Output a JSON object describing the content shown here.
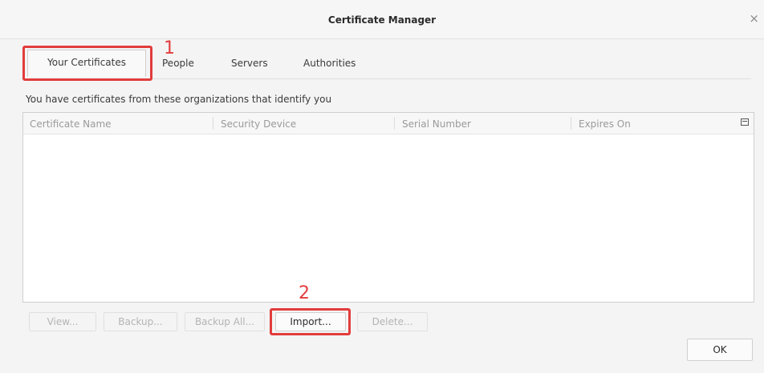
{
  "window": {
    "title": "Certificate Manager",
    "close_glyph": "×"
  },
  "tabs": [
    {
      "label": "Your Certificates",
      "selected": true
    },
    {
      "label": "People",
      "selected": false
    },
    {
      "label": "Servers",
      "selected": false
    },
    {
      "label": "Authorities",
      "selected": false
    }
  ],
  "description": "You have certificates from these organizations that identify you",
  "table": {
    "columns": [
      "Certificate Name",
      "Security Device",
      "Serial Number",
      "Expires On"
    ],
    "rows": [],
    "column_picker_icon": "column-picker-icon"
  },
  "buttons": {
    "view": "View...",
    "backup": "Backup...",
    "backup_all": "Backup All...",
    "import": "Import...",
    "delete": "Delete...",
    "ok": "OK"
  },
  "annotations": {
    "step1": "1",
    "step2": "2",
    "color": "#e23c3c"
  }
}
